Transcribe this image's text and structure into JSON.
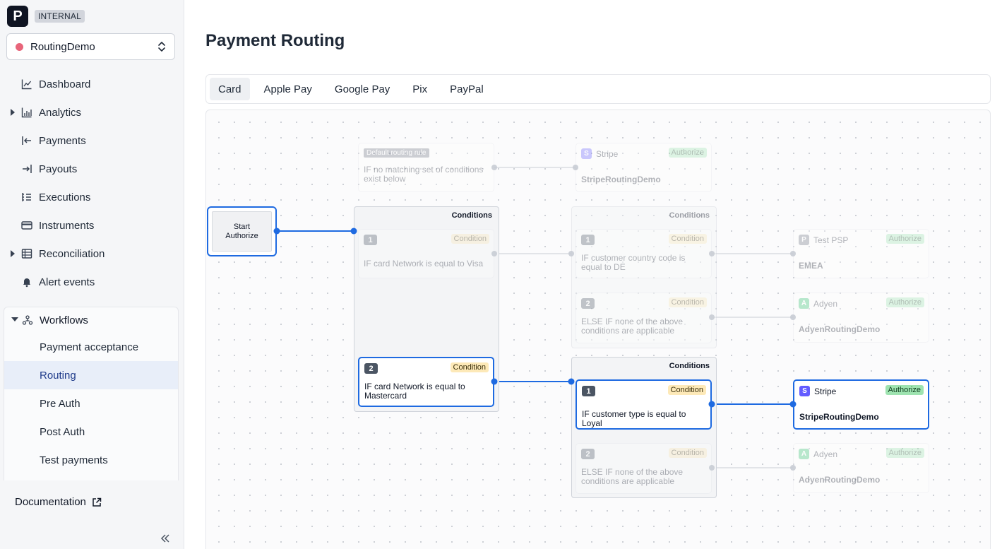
{
  "brand": {
    "logo_letter": "P",
    "env_badge": "INTERNAL"
  },
  "account": {
    "name": "RoutingDemo",
    "status_color": "#e8657a"
  },
  "nav": {
    "items": [
      {
        "label": "Dashboard",
        "icon": "chart-line-icon"
      },
      {
        "label": "Analytics",
        "icon": "bar-chart-icon",
        "expandable": true
      },
      {
        "label": "Payments",
        "icon": "arrow-in-icon"
      },
      {
        "label": "Payouts",
        "icon": "arrow-out-icon"
      },
      {
        "label": "Executions",
        "icon": "list-icon"
      },
      {
        "label": "Instruments",
        "icon": "card-icon"
      },
      {
        "label": "Reconciliation",
        "icon": "table-icon",
        "expandable": true
      },
      {
        "label": "Alert events",
        "icon": "bell-icon"
      }
    ],
    "workflows": {
      "label": "Workflows",
      "icon": "workflow-icon",
      "children": [
        "Payment acceptance",
        "Routing",
        "Pre Auth",
        "Post Auth",
        "Test payments"
      ],
      "active": "Routing"
    },
    "documentation": "Documentation"
  },
  "page": {
    "title": "Payment Routing"
  },
  "tabs": [
    "Card",
    "Apple Pay",
    "Google Pay",
    "Pix",
    "PayPal"
  ],
  "active_tab": "Card",
  "flow": {
    "start": {
      "line1": "Start",
      "line2": "Authorize"
    },
    "default_rule": {
      "chip": "Default routing rule",
      "text": "IF no matching set of conditions exist below"
    },
    "default_psp": {
      "provider": "Stripe",
      "badge": "Authorize",
      "name": "StripeRoutingDemo"
    },
    "group1": {
      "title": "Conditions",
      "conditions": [
        {
          "num": "1",
          "badge": "Condition",
          "text": "IF card Network is equal to Visa"
        },
        {
          "num": "2",
          "badge": "Condition",
          "text": "IF card Network is equal to Mastercard"
        }
      ]
    },
    "group2": {
      "title": "Conditions",
      "conditions": [
        {
          "num": "1",
          "badge": "Condition",
          "text": "IF customer country code is equal to DE"
        },
        {
          "num": "2",
          "badge": "Condition",
          "text": "ELSE IF none of the above conditions are applicable"
        }
      ]
    },
    "group3": {
      "title": "Conditions",
      "conditions": [
        {
          "num": "1",
          "badge": "Condition",
          "text": "IF customer type is equal to Loyal"
        },
        {
          "num": "2",
          "badge": "Condition",
          "text": "ELSE IF none of the above conditions are applicable"
        }
      ]
    },
    "psps": [
      {
        "provider": "Test PSP",
        "badge": "Authorize",
        "name": "EMEA"
      },
      {
        "provider": "Adyen",
        "badge": "Authorize",
        "name": "AdyenRoutingDemo"
      },
      {
        "provider": "Stripe",
        "badge": "Authorize",
        "name": "StripeRoutingDemo"
      },
      {
        "provider": "Adyen",
        "badge": "Authorize",
        "name": "AdyenRoutingDemo"
      }
    ]
  },
  "colors": {
    "active": "#1e6ae1",
    "stripe": "#635bff",
    "adyen": "#2bc06a",
    "testpsp": "#6b7280"
  }
}
